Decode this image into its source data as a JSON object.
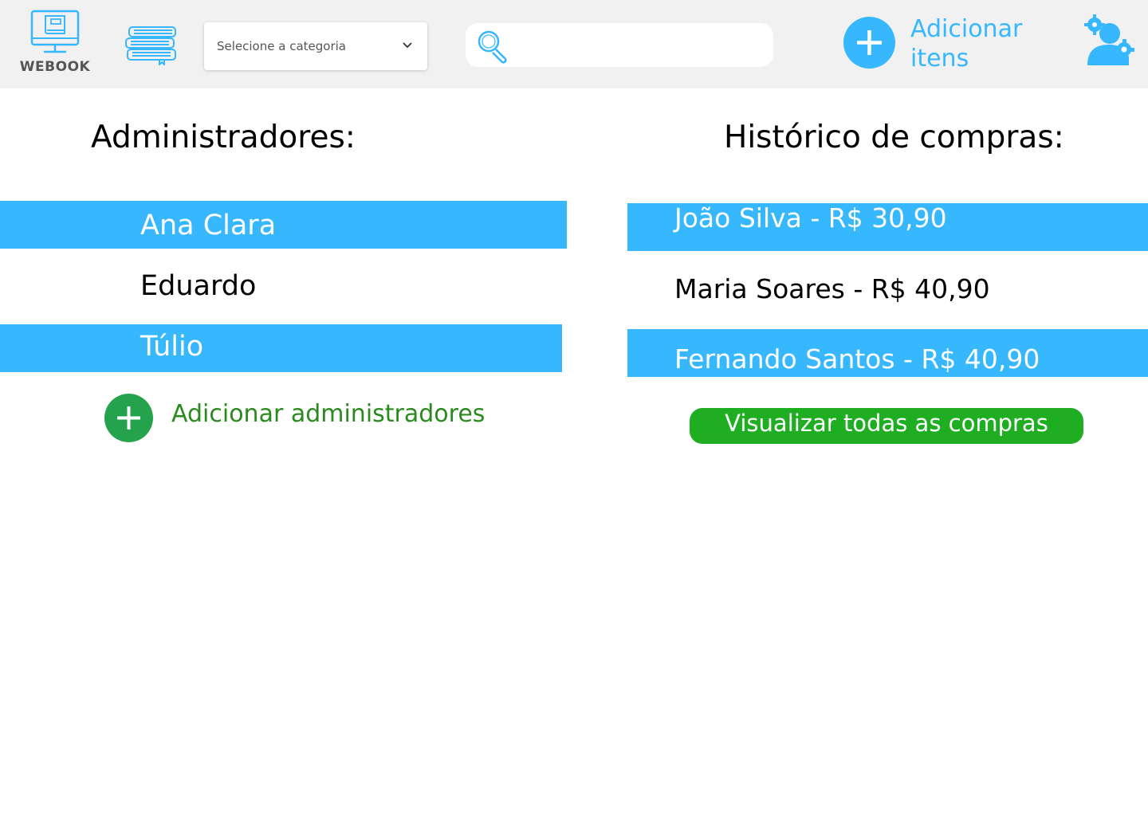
{
  "header": {
    "logo_text": "WEBOOK",
    "category_select": {
      "label": "Selecione a categoria"
    },
    "search": {
      "value": "",
      "placeholder": ""
    },
    "add_items_label_line1": "Adicionar",
    "add_items_label_line2": "itens"
  },
  "admins": {
    "title": "Administradores:",
    "items": [
      "Ana Clara",
      "Eduardo",
      "Túlio"
    ],
    "add_label": "Adicionar administradores"
  },
  "history": {
    "title": "Histórico de compras:",
    "items": [
      "João Silva - R$ 30,90",
      "Maria Soares -  R$ 40,90",
      "Fernando Santos - R$ 40,90"
    ],
    "view_all_label": "Visualizar todas as compras"
  },
  "colors": {
    "accent_blue": "#37b7fe",
    "add_green": "#25a24c",
    "button_green": "#1fae22",
    "header_bg": "#f1f1f1"
  },
  "icons": [
    "monitor-book-icon",
    "books-stack-icon",
    "chevron-down-icon",
    "search-icon",
    "plus-icon",
    "user-gear-icon"
  ]
}
